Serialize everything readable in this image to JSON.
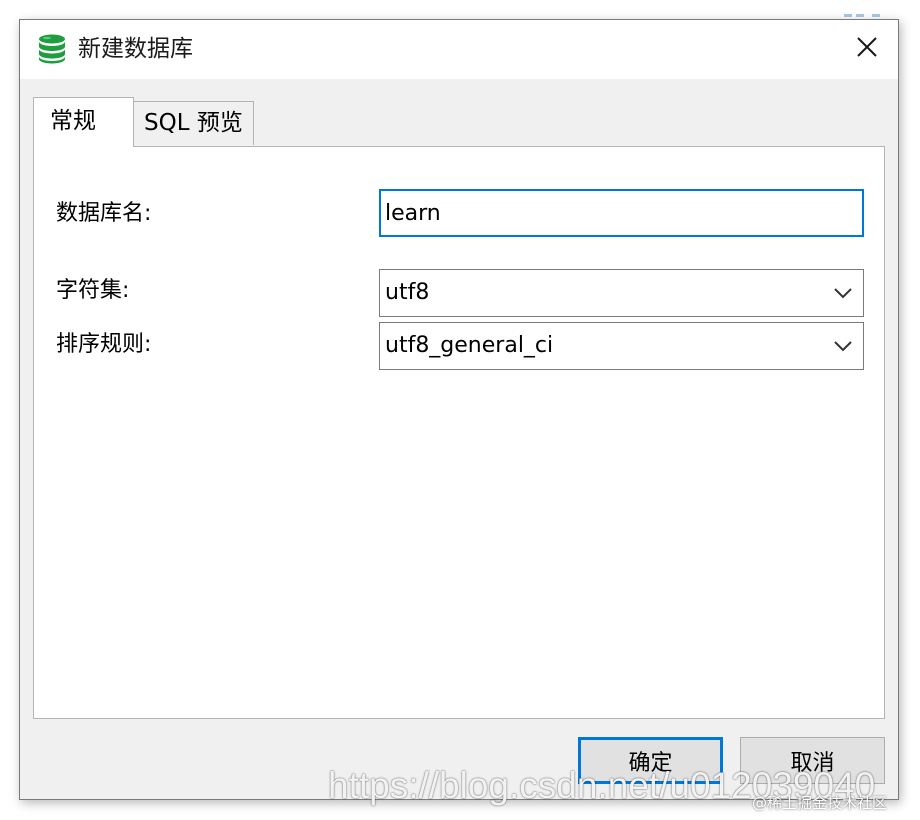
{
  "window": {
    "title": "新建数据库",
    "icon": "database-icon",
    "close_icon": "close-icon"
  },
  "tabs": [
    {
      "label": "常规",
      "active": true
    },
    {
      "label": "SQL 预览",
      "active": false
    }
  ],
  "form": {
    "db_name_label": "数据库名:",
    "db_name_value": "learn",
    "charset_label": "字符集:",
    "charset_value": "utf8",
    "collation_label": "排序规则:",
    "collation_value": "utf8_general_ci"
  },
  "buttons": {
    "ok_label": "确定",
    "cancel_label": "取消"
  },
  "watermark": {
    "url": "https://blog.csdn.net/u012039040",
    "community": "@稀土掘金技术社区"
  },
  "colors": {
    "focus_blue": "#0078d7",
    "database_icon_green": "#1e9e3e",
    "dialog_background": "#f0f0f0"
  }
}
